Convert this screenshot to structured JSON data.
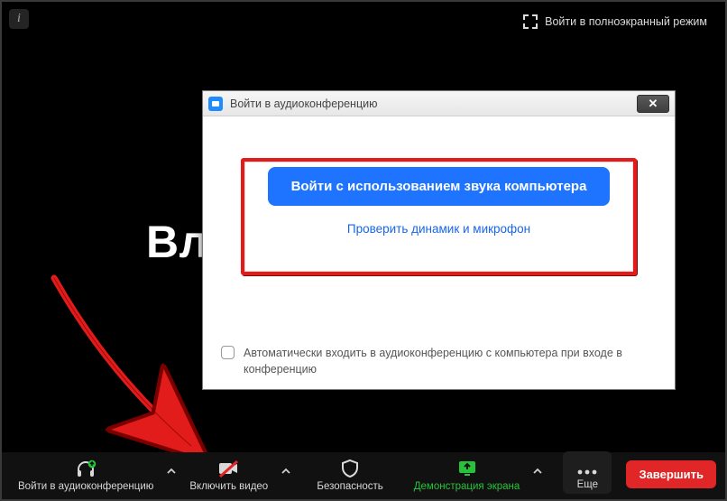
{
  "topbar": {
    "fullscreen_label": "Войти в полноэкранный режим"
  },
  "background": {
    "partial_text": "Вл"
  },
  "dialog": {
    "title": "Войти в аудиоконференцию",
    "primary_button": "Войти с использованием звука компьютера",
    "test_link": "Проверить динамик и микрофон",
    "auto_join_label": "Автоматически входить в аудиоконференцию с компьютера при входе в конференцию",
    "close_glyph": "✕"
  },
  "toolbar": {
    "audio": "Войти в аудиоконференцию",
    "video": "Включить видео",
    "security": "Безопасность",
    "share": "Демонстрация экрана",
    "more": "Еще",
    "end": "Завершить"
  }
}
